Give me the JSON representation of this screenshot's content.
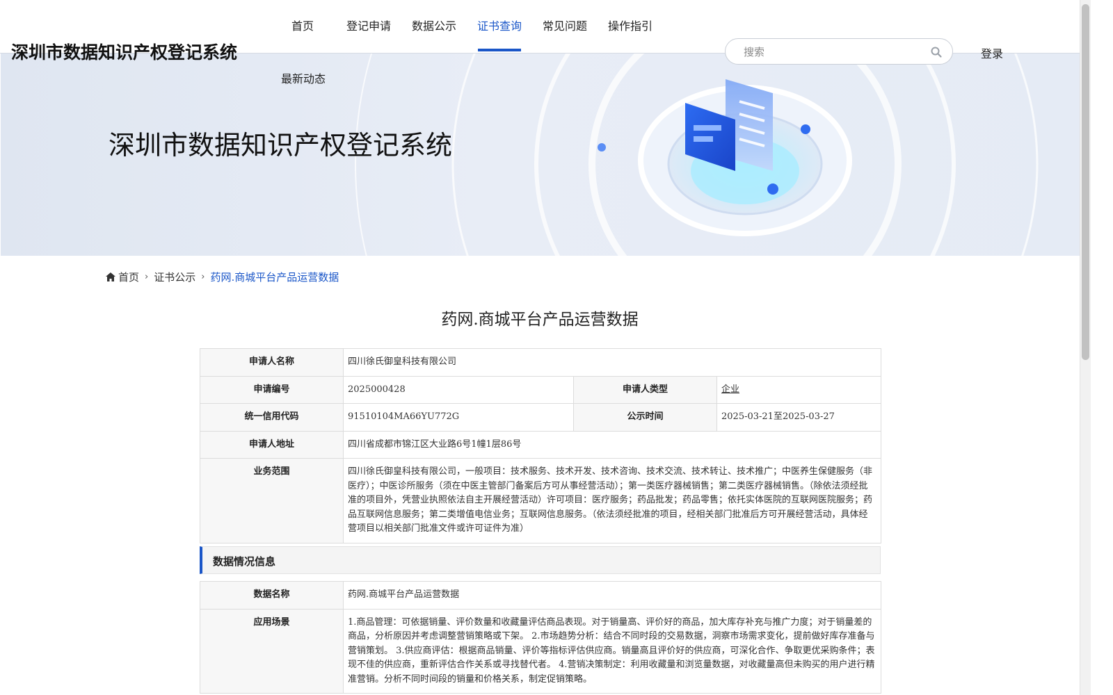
{
  "site": {
    "title": "深圳市数据知识产权登记系统"
  },
  "nav": {
    "items": [
      "首页",
      "登记申请",
      "数据公示",
      "证书查询",
      "常见问题",
      "操作指引"
    ],
    "active": "证书查询",
    "second_row": "最新动态"
  },
  "search": {
    "placeholder": "搜索"
  },
  "login": "登录",
  "banner": {
    "title": "深圳市数据知识产权登记系统"
  },
  "breadcrumb": {
    "home": "首页",
    "section": "证书公示",
    "current": "药网.商城平台产品运营数据"
  },
  "page_title": "药网.商城平台产品运营数据",
  "applicant": {
    "name_label": "申请人名称",
    "name": "四川徐氏御皇科技有限公司",
    "number_label": "申请编号",
    "number": "2025000428",
    "type_label": "申请人类型",
    "type": "企业",
    "credit_label": "统一信用代码",
    "credit": "91510104MA66YU772G",
    "period_label": "公示时间",
    "period": "2025-03-21至2025-03-27",
    "address_label": "申请人地址",
    "address": "四川省成都市锦江区大业路6号1幢1层86号",
    "scope_label": "业务范围",
    "scope": "四川徐氏御皇科技有限公司，一般项目：技术服务、技术开发、技术咨询、技术交流、技术转让、技术推广；中医养生保健服务（非医疗）；中医诊所服务（须在中医主管部门备案后方可从事经营活动）；第一类医疗器械销售；第二类医疗器械销售。（除依法须经批准的项目外，凭营业执照依法自主开展经营活动）许可项目：医疗服务；药品批发；药品零售；依托实体医院的互联网医院服务；药品互联网信息服务；第二类增值电信业务；互联网信息服务。（依法须经批准的项目，经相关部门批准后方可开展经营活动，具体经营项目以相关部门批准文件或许可证件为准）"
  },
  "data_section": {
    "title": "数据情况信息",
    "name_label": "数据名称",
    "name": "药网.商城平台产品运营数据",
    "scenario_label": "应用场景",
    "scenario": "1.商品管理：可依据销量、评价数量和收藏量评估商品表现。对于销量高、评价好的商品，加大库存补充与推广力度；对于销量差的商品，分析原因并考虑调整营销策略或下架。 2.市场趋势分析：结合不同时段的交易数据，洞察市场需求变化，提前做好库存准备与营销策划。 3.供应商评估：根据商品销量、评价等指标评估供应商。销量高且评价好的供应商，可深化合作、争取更优采购条件；表现不佳的供应商，重新评估合作关系或寻找替代者。 4.营销决策制定：利用收藏量和浏览量数据，对收藏量高但未购买的用户进行精准营销。分析不同时间段的销量和价格关系，制定促销策略。"
  },
  "colors": {
    "accent": "#1a56c8",
    "label_bg": "#f7f7f7",
    "border": "#dcdcdc"
  }
}
